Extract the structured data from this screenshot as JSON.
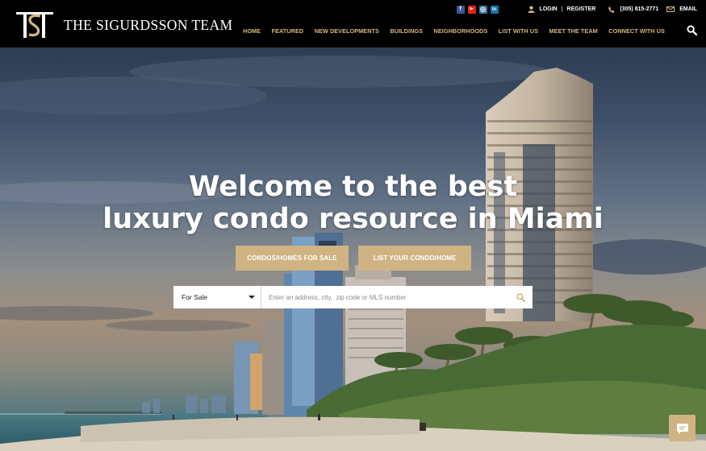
{
  "brand": {
    "name": "THE SIGURDSSON TEAM",
    "monogram": "TSH"
  },
  "topbar": {
    "social": [
      {
        "icon": "facebook-icon",
        "glyph": "f",
        "color": "#3b5998"
      },
      {
        "icon": "youtube-icon",
        "glyph": "▶",
        "color": "#e62117"
      },
      {
        "icon": "instagram-icon",
        "glyph": "◎",
        "color": "#3f729b"
      },
      {
        "icon": "linkedin-icon",
        "glyph": "in",
        "color": "#0e76a8"
      }
    ],
    "login": "LOGIN",
    "separator": "|",
    "register": "REGISTER",
    "phone": "(305) 815-2771",
    "email": "EMAIL"
  },
  "nav": {
    "items": [
      "HOME",
      "FEATURED",
      "NEW DEVELOPMENTS",
      "BUILDINGS",
      "NEIGHBORHOODS",
      "LIST WITH US",
      "MEET THE TEAM",
      "CONNECT WITH US"
    ]
  },
  "hero": {
    "line1": "Welcome to the best",
    "line2": "luxury condo resource in Miami",
    "cta_primary": "CONDOS/HOMES FOR SALE",
    "cta_secondary": "LIST YOUR CONDO/HOME"
  },
  "search": {
    "type_selected": "For Sale",
    "placeholder": "Enter an address, city,  zip code or MLS number"
  },
  "colors": {
    "gold": "#cfb383",
    "nav_gold": "#d4b882",
    "header": "#000000"
  }
}
